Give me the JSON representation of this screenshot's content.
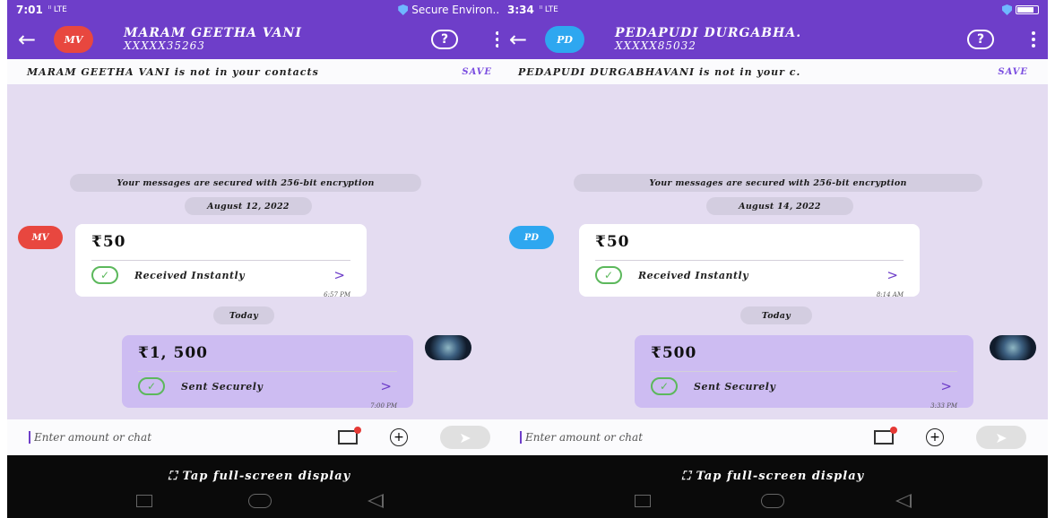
{
  "left": {
    "status": {
      "time": "7:01",
      "network": "ᴵˡ LTE",
      "right_text": "Secure Environ..."
    },
    "header": {
      "avatar": "MV",
      "avatar_color": "#e8473f",
      "name": "MARAM GEETHA VANI",
      "number": "XXXXX35263",
      "help": "?"
    },
    "notice": {
      "text": "MARAM GEETHA VANI is not in your contacts",
      "save": "SAVE"
    },
    "chat": {
      "encryption": "Your messages are secured with 256-bit encryption",
      "date": "August 12, 2022",
      "received": {
        "avatar": "MV",
        "amount": "₹50",
        "status": "Received Instantly",
        "time": "6:57 PM"
      },
      "today": "Today",
      "sent": {
        "amount": "₹1, 500",
        "status": "Sent Securely",
        "time": "7:00 PM"
      }
    },
    "input": {
      "placeholder": "Enter amount or chat"
    },
    "bottom": {
      "hint": "Tap full-screen display"
    }
  },
  "right": {
    "status": {
      "time": "3:34",
      "network": "ᴵˡ LTE",
      "right_text": ""
    },
    "header": {
      "avatar": "PD",
      "avatar_color": "#2ea7f0",
      "name": "PEDAPUDI DURGABHA.",
      "number": "XXXXX85032",
      "help": "?"
    },
    "notice": {
      "text": "PEDAPUDI DURGABHAVANI is not in your c.",
      "save": "SAVE"
    },
    "chat": {
      "encryption": "Your messages are secured with 256-bit encryption",
      "date": "August 14, 2022",
      "received": {
        "avatar": "PD",
        "amount": "₹50",
        "status": "Received Instantly",
        "time": "8:14 AM"
      },
      "today": "Today",
      "sent": {
        "amount": "₹500",
        "status": "Sent Securely",
        "time": "3:33 PM"
      }
    },
    "input": {
      "placeholder": "Enter amount or chat"
    },
    "bottom": {
      "hint": "Tap full-screen display"
    }
  },
  "colors": {
    "brand": "#6e3ec9",
    "check": "#5cb85c",
    "sent_bubble": "#cdbcf2"
  }
}
